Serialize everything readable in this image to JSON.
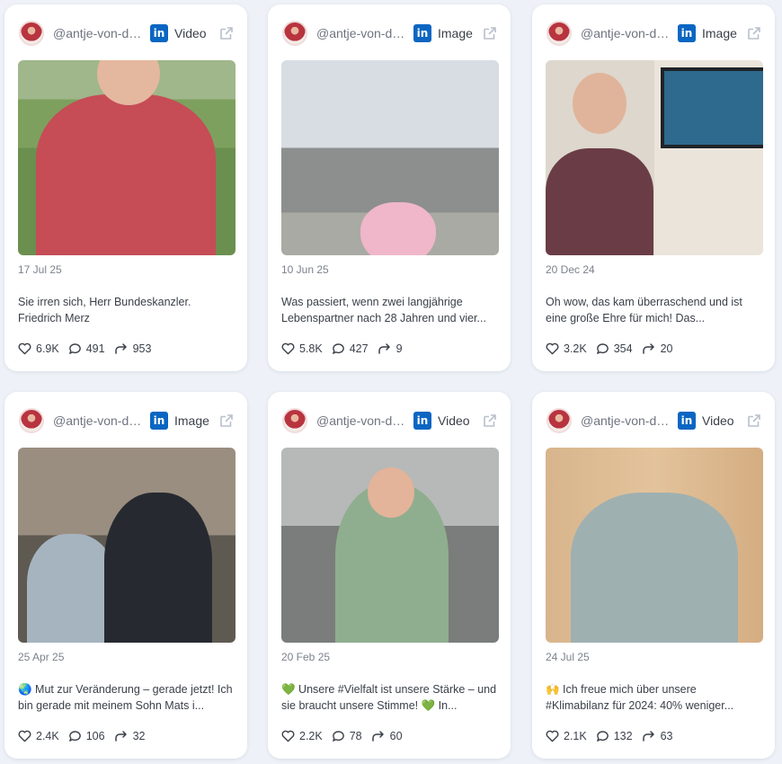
{
  "posts": [
    {
      "handle": "@antje-von-dewitz",
      "type": "Video",
      "date": "17 Jul 25",
      "text": "Sie irren sich, Herr Bundeskanzler. Friedrich Merz",
      "likes": "6.9K",
      "comments": "491",
      "shares": "953"
    },
    {
      "handle": "@antje-von-dewitz",
      "type": "Image",
      "date": "10 Jun 25",
      "text": "Was passiert, wenn zwei langjährige Lebenspartner nach 28 Jahren und vier...",
      "likes": "5.8K",
      "comments": "427",
      "shares": "9"
    },
    {
      "handle": "@antje-von-dewitz",
      "type": "Image",
      "date": "20 Dec 24",
      "text": "Oh wow, das kam überraschend und ist eine große Ehre für mich! Das...",
      "likes": "3.2K",
      "comments": "354",
      "shares": "20"
    },
    {
      "handle": "@antje-von-dewitz",
      "type": "Image",
      "date": "25 Apr 25",
      "text": "🌏 Mut zur Veränderung – gerade jetzt! Ich bin gerade mit meinem Sohn Mats i...",
      "likes": "2.4K",
      "comments": "106",
      "shares": "32"
    },
    {
      "handle": "@antje-von-dewitz",
      "type": "Video",
      "date": "20 Feb 25",
      "text": "💚 Unsere #Vielfalt ist unsere Stärke – und sie braucht unsere Stimme! 💚 In...",
      "likes": "2.2K",
      "comments": "78",
      "shares": "60"
    },
    {
      "handle": "@antje-von-dewitz",
      "type": "Video",
      "date": "24 Jul 25",
      "text": "🙌 Ich freue mich über unsere #Klimabilanz für 2024: 40% weniger...",
      "likes": "2.1K",
      "comments": "132",
      "shares": "63"
    }
  ],
  "icons": {
    "platform": "linkedin-icon",
    "external": "external-link-icon",
    "like": "heart-icon",
    "comment": "comment-icon",
    "share": "share-icon"
  },
  "colors": {
    "linkedin": "#0a66c2",
    "background": "#eef2f8",
    "card": "#ffffff"
  }
}
